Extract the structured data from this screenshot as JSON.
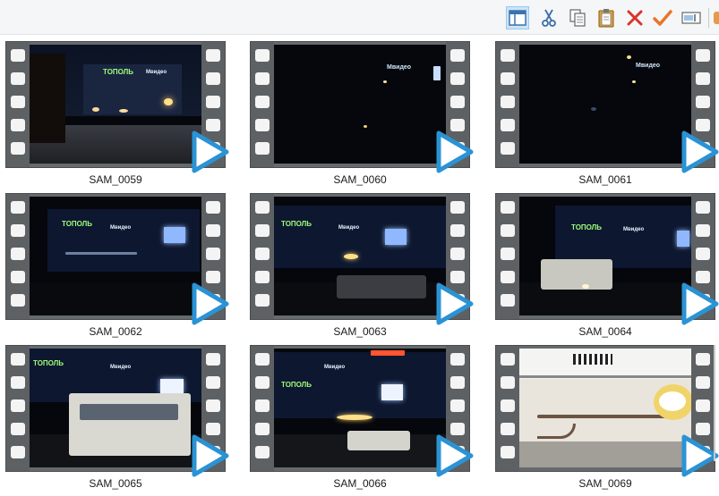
{
  "toolbar": {
    "buttons": [
      {
        "name": "layout-pane-icon",
        "active": true
      },
      {
        "name": "cut-icon"
      },
      {
        "name": "copy-icon"
      },
      {
        "name": "paste-icon"
      },
      {
        "name": "delete-icon"
      },
      {
        "name": "checkmark-icon"
      },
      {
        "name": "rename-icon"
      }
    ]
  },
  "colors": {
    "play": "#2a93d5",
    "film": "#5d6164",
    "accent_delete": "#d9352b",
    "accent_check": "#e8762a"
  },
  "files": [
    {
      "name": "SAM_0059",
      "scene": "street-lit"
    },
    {
      "name": "SAM_0060",
      "scene": "dark"
    },
    {
      "name": "SAM_0061",
      "scene": "dark"
    },
    {
      "name": "SAM_0062",
      "scene": "mall"
    },
    {
      "name": "SAM_0063",
      "scene": "mall-car"
    },
    {
      "name": "SAM_0064",
      "scene": "mall-van"
    },
    {
      "name": "SAM_0065",
      "scene": "bus"
    },
    {
      "name": "SAM_0066",
      "scene": "mall-traffic"
    },
    {
      "name": "SAM_0069",
      "scene": "indoor"
    }
  ]
}
